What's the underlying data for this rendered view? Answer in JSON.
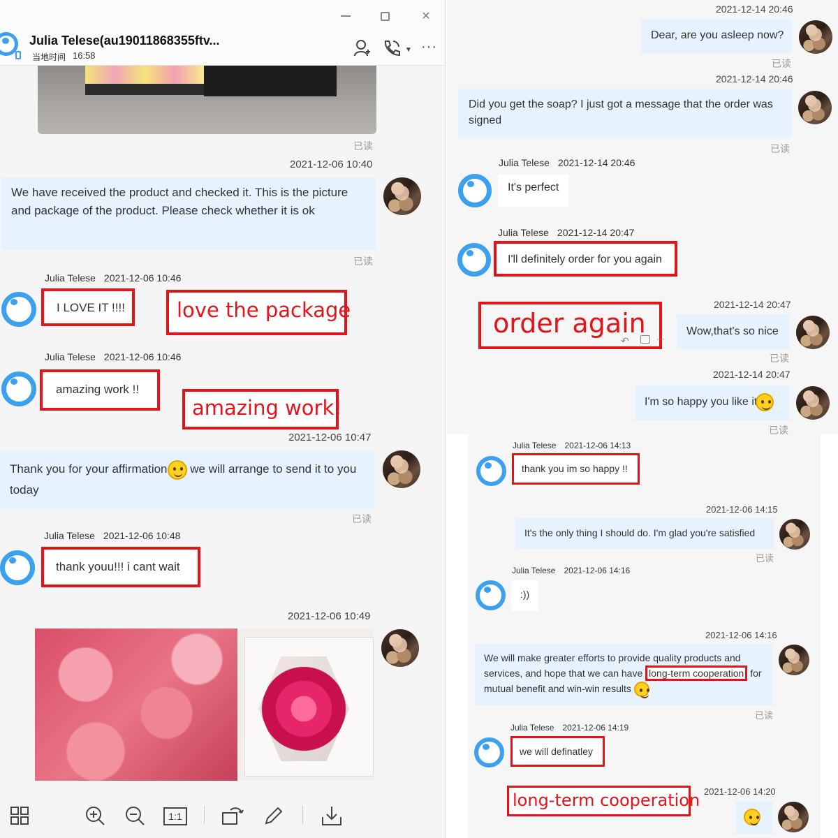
{
  "left": {
    "window": {
      "contact_name": "Julia Telese(au19011868355ftv...",
      "local_time_label": "当地时间",
      "local_time": "16:58",
      "minimize_icon": "minimize-icon",
      "maximize_icon": "maximize-icon",
      "close_icon": "close-icon"
    },
    "read_label": "已读",
    "messages": {
      "m1_time": "2021-12-06 10:40",
      "m1_text": "We have received the product and checked it. This is the picture and package of the product. Please check whether it is ok",
      "m2_sender": "Julia Telese",
      "m2_time": "2021-12-06 10:46",
      "m2_text": "I LOVE IT !!!!",
      "m3_sender": "Julia Telese",
      "m3_time": "2021-12-06 10:46",
      "m3_text": "amazing work !!",
      "m4_time": "2021-12-06 10:47",
      "m4_text_a": "Thank you for your affirmation",
      "m4_text_b": " we will arrange to send it to you today",
      "m5_sender": "Julia Telese",
      "m5_time": "2021-12-06 10:48",
      "m5_text": "thank youu!!! i cant wait",
      "m6_time": "2021-12-06 10:49"
    },
    "annotations": {
      "love_the_package": "love the package",
      "amazing_work": "amazing work!"
    },
    "toolbar": {
      "thumbnails_icon": "grid-icon",
      "zoom_in_icon": "zoom-in-icon",
      "zoom_out_icon": "zoom-out-icon",
      "actual_size_label": "1:1",
      "rotate_icon": "rotate-icon",
      "edit_icon": "pencil-icon",
      "download_icon": "download-icon"
    }
  },
  "right_top": {
    "read_label": "已读",
    "messages": {
      "m1_time": "2021-12-14 20:46",
      "m1_text": "Dear, are you asleep now?",
      "m2_time": "2021-12-14 20:46",
      "m2_text": "Did you get the soap? I just got a message that the order was signed",
      "m3_sender": "Julia Telese",
      "m3_time": "2021-12-14 20:46",
      "m3_text": "It's perfect",
      "m4_sender": "Julia Telese",
      "m4_time": "2021-12-14 20:47",
      "m4_text": "I'll definitely order for you again",
      "m5_time": "2021-12-14 20:47",
      "m5_text": "Wow,that's so nice",
      "m6_time": "2021-12-14 20:47",
      "m6_text": "I'm so happy you like it"
    },
    "annotations": {
      "order_again": "order again"
    }
  },
  "right_bottom": {
    "read_label": "已读",
    "messages": {
      "m1_sender": "Julia Telese",
      "m1_time": "2021-12-06 14:13",
      "m1_text": "thank you im so happy !!",
      "m2_time": "2021-12-06 14:15",
      "m2_text": "It's the only thing I should do. I'm glad you're satisfied",
      "m3_sender": "Julia Telese",
      "m3_time": "2021-12-06 14:16",
      "m3_text": ":))",
      "m4_time": "2021-12-06 14:16",
      "m4_text_a": "We will make greater efforts to provide quality products and services, and hope that we can have",
      "m4_text_highlight": "long-term cooperation",
      "m4_text_b": "for mutual benefit and win-win results",
      "m5_sender": "Julia Telese",
      "m5_time": "2021-12-06 14:19",
      "m5_text": "we will definatley",
      "m6_time": "2021-12-06 14:20"
    },
    "annotations": {
      "long_term": "long-term cooperation"
    }
  },
  "colors": {
    "accent_red": "#e3131a",
    "bubble_blue": "#e6f2fd",
    "ring_blue": "#3aa0ef"
  }
}
